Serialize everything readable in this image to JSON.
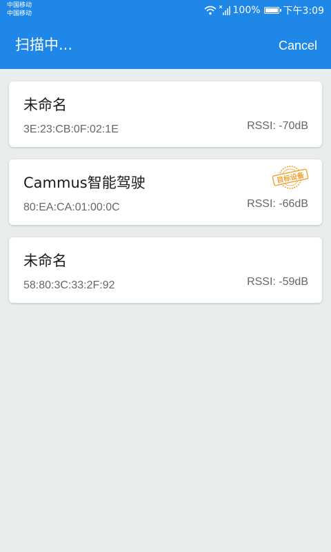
{
  "status_bar": {
    "carrier_1": "中国移动",
    "carrier_2": "中国移动",
    "battery": "100%",
    "time": "下午3:09"
  },
  "app_bar": {
    "title": "扫描中...",
    "cancel_label": "Cancel"
  },
  "devices": [
    {
      "name": "未命名",
      "mac": "3E:23:CB:0F:02:1E",
      "rssi": "RSSI: -70dB"
    },
    {
      "name": "Cammus智能驾驶",
      "mac": "80:EA:CA:01:00:0C",
      "rssi": "RSSI: -66dB",
      "badge": "目标设备"
    },
    {
      "name": "未命名",
      "mac": "58:80:3C:33:2F:92",
      "rssi": "RSSI: -59dB"
    }
  ],
  "colors": {
    "primary": "#1e87e8",
    "background": "#e9edec",
    "badge": "#f0a030"
  }
}
